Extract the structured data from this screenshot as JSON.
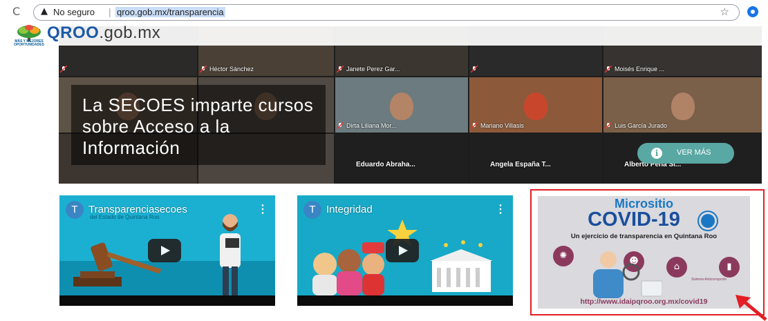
{
  "browser": {
    "security_label": "No seguro",
    "url": "qroo.gob.mx/transparencia",
    "separator": "|"
  },
  "header": {
    "brand_bold": "QROO",
    "brand_rest": ".gob.mx",
    "logo_tagline": "MÁS Y MEJORES OPORTUNIDADES"
  },
  "hero": {
    "caption": "La SECOES imparte cursos sobre Acceso a la Información",
    "cta_label": "VER MÁS",
    "participants": {
      "hector": "Héctor Sánchez",
      "janete": "Janete Perez Gar...",
      "moises": "Moisés Enrique ...",
      "dirta": "Dirta Liliana Mor...",
      "mariano": "Mariano Villasis",
      "luis": "Luis García Jurado",
      "eduardo": "Eduardo Abraha...",
      "angela": "Angela España T...",
      "alberto": "Alberto Pena Sí..."
    }
  },
  "videos": [
    {
      "avatar": "T",
      "title": "Transparenciasecoes",
      "subtitle": "del Estado de Quintana Roo",
      "menu": "⋮"
    },
    {
      "avatar": "T",
      "title": "Integridad",
      "menu": "⋮"
    }
  ],
  "covid": {
    "top": "Micrositio",
    "main": "COVID-19",
    "subtitle": "Un ejercicio de transparencia en Quintana Roo",
    "url": "http://www.idaipqroo.org.mx/covid19",
    "org": "Sistema Anticorrupción"
  },
  "colors": {
    "brand_blue": "#1c5aa8",
    "teal_button": "#5aa8a3",
    "highlight_red": "#e31e24",
    "video_bg": "#1aa6c9"
  }
}
